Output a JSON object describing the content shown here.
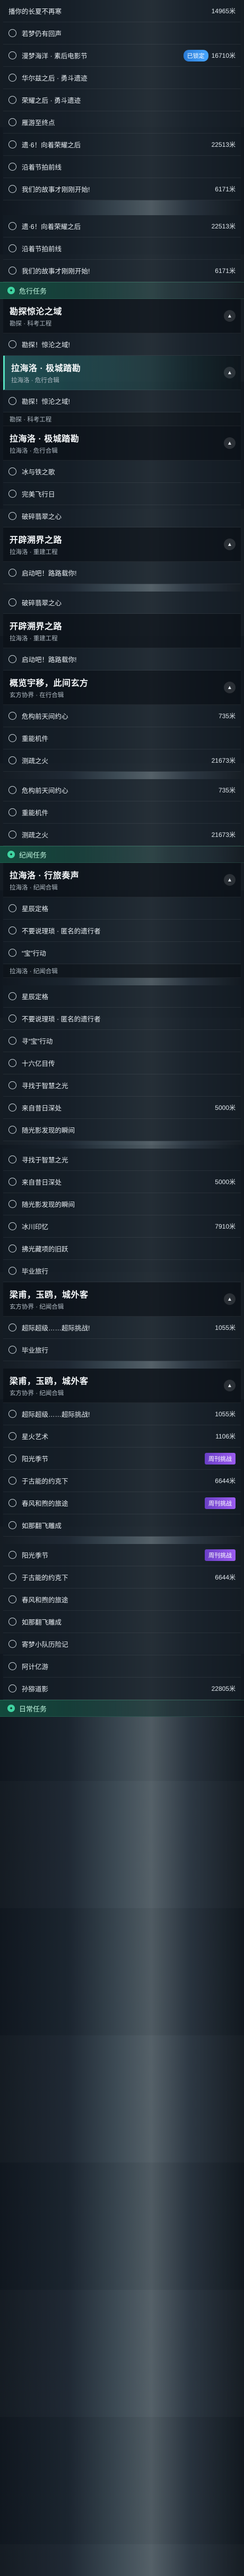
{
  "blocks": [
    {
      "kind": "row",
      "label": "播你的长夏不再寒",
      "dist": "14965米",
      "first": true
    },
    {
      "kind": "row",
      "label": "若梦仍有回声",
      "dist": ""
    },
    {
      "kind": "row",
      "label": "漫梦海洋 · 素后电影节",
      "dist": "16710米",
      "badge2": "已锁定"
    },
    {
      "kind": "row",
      "label": "华尔兹之后 · 勇斗遗迹",
      "dist": ""
    },
    {
      "kind": "row",
      "label": "荣耀之后 · 勇斗遗迹",
      "dist": ""
    },
    {
      "kind": "row",
      "label": "雁游至终点",
      "dist": ""
    },
    {
      "kind": "row",
      "label": "遗·6！向着荣耀之后",
      "dist": "22513米"
    },
    {
      "kind": "row",
      "label": "沿着节拍前线",
      "dist": ""
    },
    {
      "kind": "row",
      "label": "我们的故事才刚刚开始!",
      "dist": "6171米"
    },
    {
      "kind": "spacer-lg"
    },
    {
      "kind": "row",
      "label": "遗·6！向着荣耀之后",
      "dist": "22513米"
    },
    {
      "kind": "row",
      "label": "沿着节拍前线",
      "dist": ""
    },
    {
      "kind": "row",
      "label": "我们的故事才刚刚开始!",
      "dist": "6171米"
    },
    {
      "kind": "section",
      "title": "危行任务",
      "icon": "✦",
      "variant": "green"
    },
    {
      "kind": "chapter",
      "title": "勘探惊沦之域",
      "sub": "勘探 · 科考工程",
      "toggle": "▲"
    },
    {
      "kind": "row",
      "label": "勘探！惊沦之域!",
      "dist": ""
    },
    {
      "kind": "chapter",
      "title": "拉海洛 · 极城踏勘",
      "sub": "拉海洛 · 危行合辑",
      "toggle": "▲",
      "highlight": true
    },
    {
      "kind": "row",
      "label": "勘探！惊沦之域!",
      "dist": ""
    },
    {
      "kind": "subhead",
      "text": "勘探 · 科考工程"
    },
    {
      "kind": "chapter",
      "title": "拉海洛 · 极城踏勘",
      "sub": "拉海洛 · 危行合辑",
      "toggle": "▲"
    },
    {
      "kind": "row",
      "label": "冰与铁之歌",
      "dist": ""
    },
    {
      "kind": "row",
      "label": "完美飞行日",
      "dist": ""
    },
    {
      "kind": "row",
      "label": "破碎翡翠之心",
      "dist": ""
    },
    {
      "kind": "chapter",
      "title": "开辟溯界之路",
      "sub": "拉海洛 · 重建工程",
      "toggle": "▲"
    },
    {
      "kind": "row",
      "label": "启动吧！路路载你!",
      "dist": ""
    },
    {
      "kind": "spacer"
    },
    {
      "kind": "row",
      "label": "破碎翡翠之心",
      "dist": ""
    },
    {
      "kind": "chapter",
      "title": "开辟溯界之路",
      "sub": "拉海洛 · 重建工程",
      "toggle": ""
    },
    {
      "kind": "row",
      "label": "启动吧！路路载你!",
      "dist": ""
    },
    {
      "kind": "chapter",
      "title": "概览宇移，此间玄方",
      "sub": "玄方协界 · 在行合辑",
      "toggle": "▲"
    },
    {
      "kind": "row",
      "label": "危构前天间约心",
      "dist": "735米"
    },
    {
      "kind": "row",
      "label": "重能机件",
      "dist": ""
    },
    {
      "kind": "row",
      "label": "测疏之火",
      "dist": "21673米"
    },
    {
      "kind": "spacer"
    },
    {
      "kind": "row",
      "label": "危构前天间约心",
      "dist": "735米"
    },
    {
      "kind": "row",
      "label": "重能机件",
      "dist": ""
    },
    {
      "kind": "row",
      "label": "测疏之火",
      "dist": "21673米"
    },
    {
      "kind": "section",
      "title": "纪闻任务",
      "icon": "✦",
      "variant": "green"
    },
    {
      "kind": "chapter",
      "title": "拉海洛 · 行旅奏声",
      "sub": "拉海洛 · 纪闻合辑",
      "toggle": "▲"
    },
    {
      "kind": "row",
      "label": "星辰定格",
      "dist": ""
    },
    {
      "kind": "row",
      "label": "不要说理琐 · 匿名的遗行者",
      "dist": ""
    },
    {
      "kind": "row",
      "label": "“宝”行动",
      "dist": ""
    },
    {
      "kind": "subhead",
      "text": "拉海洛 · 纪闻合辑"
    },
    {
      "kind": "spacer"
    },
    {
      "kind": "row",
      "label": "星辰定格",
      "dist": ""
    },
    {
      "kind": "row",
      "label": "不要说理琐 · 匿名的遗行者",
      "dist": ""
    },
    {
      "kind": "row",
      "label": "寻“宝”行动",
      "dist": ""
    },
    {
      "kind": "row",
      "label": "十六亿目传",
      "dist": ""
    },
    {
      "kind": "row",
      "label": "寻找于智慧之光",
      "dist": ""
    },
    {
      "kind": "row",
      "label": "来自昔日深处",
      "dist": "5000米"
    },
    {
      "kind": "row",
      "label": "随光影发现的瞬间",
      "dist": ""
    },
    {
      "kind": "spacer"
    },
    {
      "kind": "row",
      "label": "寻找于智慧之光",
      "dist": ""
    },
    {
      "kind": "row",
      "label": "来自昔日深处",
      "dist": "5000米"
    },
    {
      "kind": "row",
      "label": "随光影发现的瞬间",
      "dist": ""
    },
    {
      "kind": "row",
      "label": "冰川印忆",
      "dist": "7910米"
    },
    {
      "kind": "row",
      "label": "拂光藏项的旧跃",
      "dist": ""
    },
    {
      "kind": "row",
      "label": "毕业旅行",
      "dist": ""
    },
    {
      "kind": "chapter",
      "title": "梁甫，玉鸥，城外客",
      "sub": "玄方协界 · 纪闻合辑",
      "toggle": "▲"
    },
    {
      "kind": "row",
      "label": "超际超级……超际挑战!",
      "dist": "1055米"
    },
    {
      "kind": "row",
      "label": "毕业旅行",
      "dist": ""
    },
    {
      "kind": "spacer"
    },
    {
      "kind": "chapter",
      "title": "梁甫，玉鸥，城外客",
      "sub": "玄方协界 · 纪闻合辑",
      "toggle": "▲"
    },
    {
      "kind": "row",
      "label": "超际超级……超际挑战!",
      "dist": "1055米"
    },
    {
      "kind": "row",
      "label": "星火艺术",
      "dist": "1106米"
    },
    {
      "kind": "row",
      "label": "阳光季节",
      "dist": "",
      "badge": "周刊挑战"
    },
    {
      "kind": "row",
      "label": "于古能的约克下",
      "dist": "6644米"
    },
    {
      "kind": "row",
      "label": "春风和煦的旅途",
      "dist": "",
      "badge": "周刊挑战"
    },
    {
      "kind": "row",
      "label": "如那翻飞雕成",
      "dist": ""
    },
    {
      "kind": "spacer"
    },
    {
      "kind": "row",
      "label": "阳光季节",
      "dist": "",
      "badge": "周刊挑战"
    },
    {
      "kind": "row",
      "label": "于古能的约克下",
      "dist": "6644米"
    },
    {
      "kind": "row",
      "label": "春风和煦的旅途",
      "dist": ""
    },
    {
      "kind": "row",
      "label": "如那翻飞雕成",
      "dist": ""
    },
    {
      "kind": "row",
      "label": "寄梦小队历险记",
      "dist": ""
    },
    {
      "kind": "row",
      "label": "阿计亿游",
      "dist": ""
    },
    {
      "kind": "row",
      "label": "孙猕道影",
      "dist": "22805米"
    },
    {
      "kind": "section",
      "title": "日常任务",
      "icon": "✦",
      "variant": "green"
    }
  ]
}
